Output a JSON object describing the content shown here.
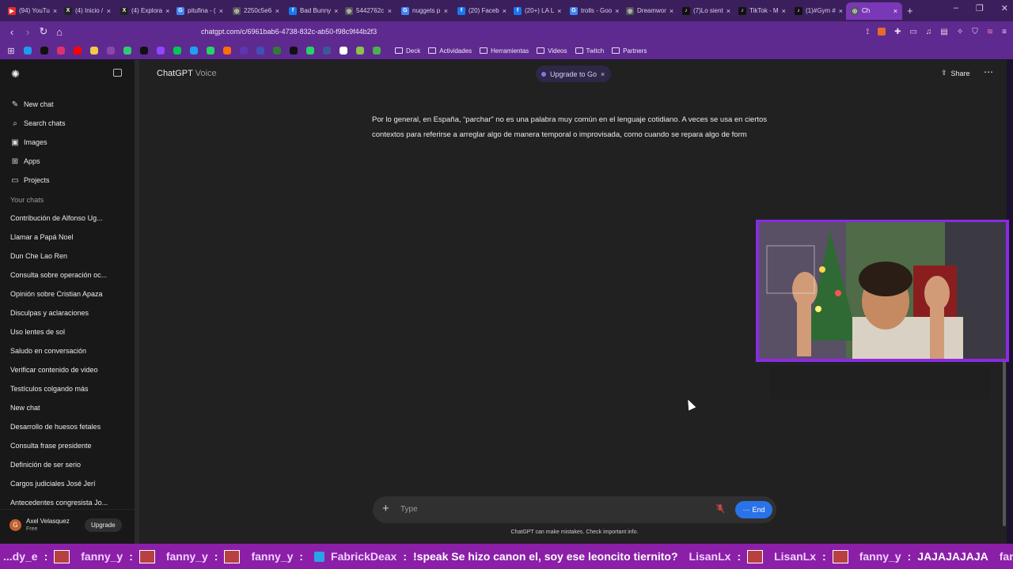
{
  "browser": {
    "tabs": [
      {
        "label": "(94) YouTu",
        "color": "#e52d27",
        "glyph": "▶"
      },
      {
        "label": "(4) Inicio /",
        "color": "#222222",
        "glyph": "X"
      },
      {
        "label": "(4) Explora",
        "color": "#222222",
        "glyph": "X"
      },
      {
        "label": "pitufina - (",
        "color": "#4285f4",
        "glyph": "G"
      },
      {
        "label": "2250c5e6",
        "color": "#555555",
        "glyph": "◎"
      },
      {
        "label": "Bad Bunny",
        "color": "#1877f2",
        "glyph": "f"
      },
      {
        "label": "5442762c",
        "color": "#555555",
        "glyph": "◎"
      },
      {
        "label": "nuggets p",
        "color": "#4285f4",
        "glyph": "G"
      },
      {
        "label": "(20) Faceb",
        "color": "#1877f2",
        "glyph": "f"
      },
      {
        "label": "(20+) LA L",
        "color": "#1877f2",
        "glyph": "f"
      },
      {
        "label": "trolls - Goo",
        "color": "#4285f4",
        "glyph": "G"
      },
      {
        "label": "Dreamwor",
        "color": "#555555",
        "glyph": "◎"
      },
      {
        "label": "(7)Lo sient",
        "color": "#111111",
        "glyph": "♪"
      },
      {
        "label": "TikTok - M",
        "color": "#111111",
        "glyph": "♪"
      },
      {
        "label": "(1)#Gym #",
        "color": "#111111",
        "glyph": "♪"
      },
      {
        "label": "Ch",
        "color": "#555555",
        "glyph": "◎",
        "active": true
      }
    ],
    "new_tab_glyph": "+",
    "url": "chatgpt.com/c/6961bab6-4738-832c-ab50-f98c9f44b2f3",
    "bookmark_folders": [
      "Deck",
      "Actividades",
      "Herramientas",
      "Videos",
      "Twitch",
      "Partners"
    ],
    "bookmark_icon_colors": [
      "#1d9bf0",
      "#111111",
      "#e1306c",
      "#ff0000",
      "#f2c94c",
      "#8e44ad",
      "#2ecc71",
      "#111111",
      "#9146ff",
      "#00c853",
      "#1da1f2",
      "#25d366",
      "#ff6f00",
      "#5e35b1",
      "#3f51b5",
      "#2e7d32",
      "#111111",
      "#25d366",
      "#3b5998",
      "#ffffff",
      "#8bc34a",
      "#4caf50"
    ]
  },
  "sidebar": {
    "nav": [
      {
        "label": "New chat",
        "icon": "pencil-icon",
        "glyph": "✎"
      },
      {
        "label": "Search chats",
        "icon": "search-icon",
        "glyph": "⌕"
      },
      {
        "label": "Images",
        "icon": "image-icon",
        "glyph": "▣"
      },
      {
        "label": "Apps",
        "icon": "apps-icon",
        "glyph": "⊞"
      },
      {
        "label": "Projects",
        "icon": "folder-icon",
        "glyph": "▭"
      }
    ],
    "section_title": "Your chats",
    "chats": [
      "Contribución de Alfonso Ug...",
      "Llamar a Papá Noel",
      "Dun Che Lao Ren",
      "Consulta sobre operación oc...",
      "Opinión sobre Cristian Apaza",
      "Disculpas y aclaraciones",
      "Uso lentes de sol",
      "Saludo en conversación",
      "Verificar contenido de video",
      "Testículos colgando más",
      "New chat",
      "Desarrollo de huesos fetales",
      "Consulta frase presidente",
      "Definición de ser serio",
      "Cargos judiciales José Jerí",
      "Antecedentes congresista Jo..."
    ],
    "user": {
      "initial": "G",
      "name": "Axel Velasquez",
      "plan": "Free",
      "upgrade_label": "Upgrade"
    }
  },
  "header": {
    "title": "ChatGPT",
    "subtitle": "Voice",
    "upgrade_pill": "Upgrade to Go",
    "pill_close": "×",
    "share_label": "Share",
    "share_glyph": "⇪",
    "more_glyph": "⋯"
  },
  "conversation": {
    "message": "Por lo general, en España, “parchar” no es una palabra muy común en el lenguaje cotidiano. A veces se usa en ciertos contextos para referirse a arreglar algo de manera temporal o improvisada, como cuando se repara algo de form"
  },
  "composer": {
    "placeholder": "Type",
    "plus_glyph": "+",
    "end_label": "End",
    "end_glyph": "···",
    "disclaimer": "ChatGPT can make mistakes. Check important info."
  },
  "stream_chat": [
    {
      "user": "...dy_e",
      "text": "",
      "emote": true
    },
    {
      "user": "fanny_y",
      "text": "",
      "emote": true
    },
    {
      "user": "fanny_y",
      "text": "",
      "emote": true
    },
    {
      "user": "fanny_y",
      "text": "",
      "emote": false
    },
    {
      "user": "FabrickDeax",
      "text": "!speak Se hizo canon el, soy ese leoncito tiernito?",
      "emote": false,
      "badge": true
    },
    {
      "user": "LisanLx",
      "text": "",
      "emote": true
    },
    {
      "user": "LisanLx",
      "text": "",
      "emote": true
    },
    {
      "user": "fanny_y",
      "text": "JAJAJAJAJA",
      "emote": false
    },
    {
      "user": "fanny_y",
      "text": "",
      "emote": true
    }
  ]
}
